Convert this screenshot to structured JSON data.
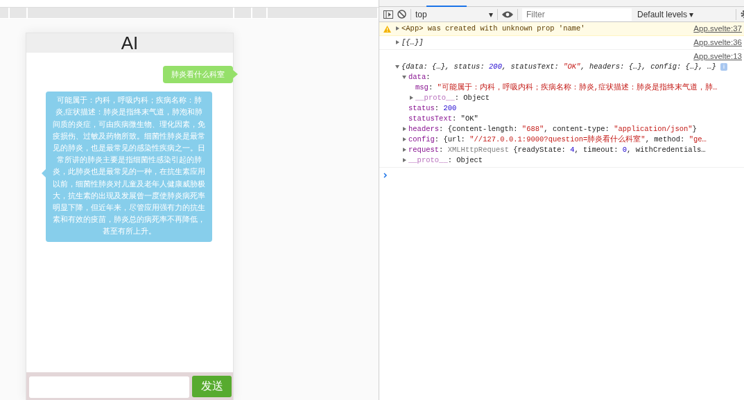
{
  "chat": {
    "title": "AI",
    "messages": [
      {
        "kind": "user",
        "text": "肺炎看什么科室"
      },
      {
        "kind": "bot",
        "text": "可能属于：内科，呼吸内科；疾病名称：肺炎,症状描述：肺炎是指终末气道，肺泡和肺间质的炎症，可由疾病微生物、理化因素，免疫损伤、过敏及药物所致。细菌性肺炎是最常见的肺炎，也是最常见的感染性疾病之一。日常所讲的肺炎主要是指细菌性感染引起的肺炎，此肺炎也是最常见的一种，在抗生素应用以前，细菌性肺炎对儿童及老年人健康威胁极大，抗生素的出现及发展曾一度使肺炎病死率明显下降，但近年来，尽管应用强有力的抗生素和有效的疫苗，肺炎总的病死率不再降低，甚至有所上升。"
      }
    ],
    "send_button": "发送"
  },
  "console": {
    "toolbar": {
      "context": "top",
      "filter_placeholder": "Filter",
      "levels": "Default levels ▾",
      "context_arrow": "▾"
    },
    "messages": [
      {
        "kind": "warning",
        "expanded": false,
        "source": "App.svelte:37",
        "tokens": [
          {
            "kind": "plain",
            "text": "<App> was created with unknown prop 'name'"
          }
        ]
      },
      {
        "kind": "log",
        "expanded": false,
        "source": "App.svelte:36",
        "tokens": [
          {
            "kind": "plain",
            "text": "[{…}]"
          }
        ]
      },
      {
        "kind": "log",
        "expanded": true,
        "source": "App.svelte:13",
        "info_badge": "i",
        "tokens": [
          {
            "kind": "plain",
            "text": "{data: {…}, status: "
          },
          {
            "kind": "number",
            "text": "200"
          },
          {
            "kind": "plain",
            "text": ", statusText: "
          },
          {
            "kind": "string",
            "text": "\"OK\""
          },
          {
            "kind": "plain",
            "text": ", headers: {…}, config: {…}, …}"
          }
        ],
        "children": [
          {
            "key": "data",
            "dimmed": false,
            "expanded": true,
            "tokens": [
              {
                "kind": "plain",
                "text": ":"
              }
            ],
            "children": [
              {
                "key": "msg",
                "dimmed": false,
                "tokens": [
                  {
                    "kind": "plain",
                    "text": ": "
                  },
                  {
                    "kind": "string",
                    "text": "\"可能属于：内科，呼吸内科；疾病名称：肺炎,症状描述：肺炎是指终末气道，肺…"
                  }
                ]
              },
              {
                "key": "__proto__",
                "dimmed": true,
                "expanded": false,
                "tokens": [
                  {
                    "kind": "plain",
                    "text": ": Object"
                  }
                ]
              }
            ]
          },
          {
            "key": "status",
            "dimmed": false,
            "tokens": [
              {
                "kind": "plain",
                "text": ": "
              },
              {
                "kind": "number",
                "text": "200"
              }
            ]
          },
          {
            "key": "statusText",
            "dimmed": false,
            "tokens": [
              {
                "kind": "plain",
                "text": ": \"OK\""
              }
            ]
          },
          {
            "key": "headers",
            "dimmed": false,
            "expanded": false,
            "tokens": [
              {
                "kind": "plain",
                "text": ": {content-length: "
              },
              {
                "kind": "string",
                "text": "\"688\""
              },
              {
                "kind": "plain",
                "text": ", content-type: "
              },
              {
                "kind": "string",
                "text": "\"application/json\""
              },
              {
                "kind": "plain",
                "text": "}"
              }
            ]
          },
          {
            "key": "config",
            "dimmed": false,
            "expanded": false,
            "tokens": [
              {
                "kind": "plain",
                "text": ": {url: "
              },
              {
                "kind": "string",
                "text": "\"//127.0.0.1:9000?question=肺炎看什么科室\""
              },
              {
                "kind": "plain",
                "text": ", method: "
              },
              {
                "kind": "string",
                "text": "\"ge…"
              }
            ]
          },
          {
            "key": "request",
            "dimmed": false,
            "expanded": false,
            "tokens": [
              {
                "kind": "plain",
                "text": ": "
              },
              {
                "kind": "type",
                "text": "XMLHttpRequest"
              },
              {
                "kind": "plain",
                "text": " {readyState: "
              },
              {
                "kind": "number",
                "text": "4"
              },
              {
                "kind": "plain",
                "text": ", timeout: "
              },
              {
                "kind": "number",
                "text": "0"
              },
              {
                "kind": "plain",
                "text": ", withCredentials…"
              }
            ]
          },
          {
            "key": "__proto__",
            "dimmed": true,
            "expanded": false,
            "tokens": [
              {
                "kind": "plain",
                "text": ": Object"
              }
            ]
          }
        ]
      }
    ]
  }
}
